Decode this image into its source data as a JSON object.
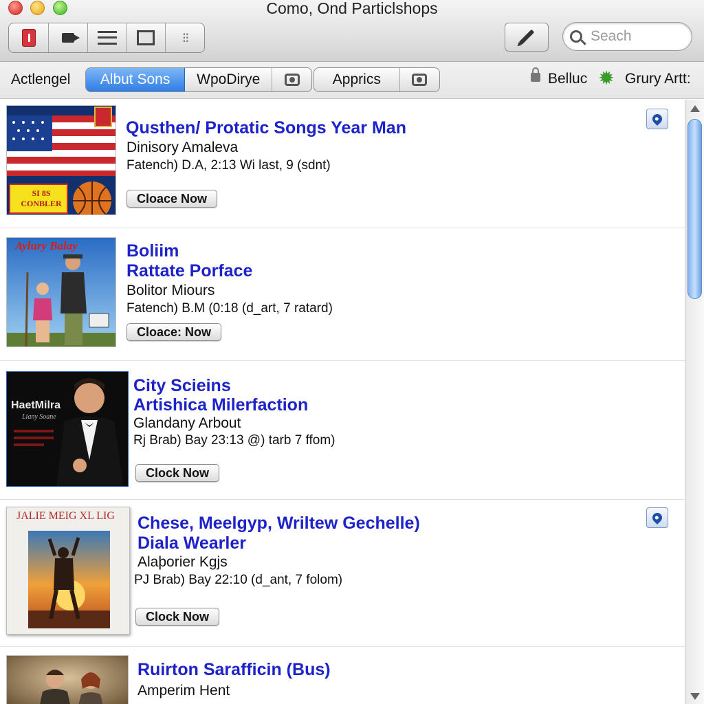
{
  "window": {
    "title": "Como, Ond Particlshops"
  },
  "toolbar": {
    "buttons": [
      "stop-icon",
      "video-icon",
      "list-icon",
      "frame-icon",
      "grip-icon"
    ],
    "edit_icon": "pen-icon",
    "search": {
      "placeholder": "Seach",
      "value": ""
    }
  },
  "filterbar": {
    "label": "Actlengel",
    "segments_left": [
      {
        "label": "Albut Sons",
        "active": true
      },
      {
        "label": "WpoDirye",
        "active": false
      },
      {
        "label": "",
        "icon": "camera-icon"
      }
    ],
    "segments_right": [
      {
        "label": "Apprics"
      },
      {
        "label": "",
        "icon": "camera-icon"
      }
    ],
    "lock_label": "Belluc",
    "gear_label": "Grury Artt:"
  },
  "items": [
    {
      "title_lines": [
        "Qusthen/ Protatic Songs Year Man"
      ],
      "subtitle": "Dinisory Amaleva",
      "meta": "Fatench) D.A, 2:13 Wi last, 9 (sdnt)",
      "action": "Cloace Now",
      "pinned": true,
      "cover": {
        "caption": "SI 8S CONBLER"
      }
    },
    {
      "title_lines": [
        "Boliim",
        "Rattate Porface"
      ],
      "subtitle": "Bolitor Miours",
      "meta": "Fatench) B.M (0:18 (d_art, 7 ratard)",
      "action": "Cloace: Now",
      "pinned": false,
      "cover": {
        "caption": "Aylury Balay"
      }
    },
    {
      "title_lines": [
        "City Scieins",
        "Artishica Milerfaction"
      ],
      "subtitle": "Glandany Arbout",
      "meta": "Rj Brab) Bay 23:13 @) tarb 7 ffom)",
      "action": "Clock Now",
      "pinned": false,
      "cover": {
        "caption": "HaetMilra",
        "subcaption": "Liany Soane"
      }
    },
    {
      "title_lines": [
        "Chese, Meelgyp, Wriltew Gechelle)",
        "Diala Wearler"
      ],
      "subtitle": "Alaþorier Kgjs",
      "meta": "PJ Brab) Bay 22:10 (d_ant, 7 folom)",
      "action": "Clock Now",
      "pinned": true,
      "cover": {
        "caption": "JALIE MEIG XL LIG"
      }
    },
    {
      "title_lines": [
        "Ruirton Sarafficin (Bus)"
      ],
      "subtitle": "Amperim Hent",
      "meta": "",
      "action": "",
      "pinned": false,
      "cover": {
        "caption": ""
      }
    }
  ],
  "colors": {
    "title_blue": "#1d23c9",
    "segment_active": "#2f7de4",
    "scroll_thumb": "#7fb1ee"
  }
}
